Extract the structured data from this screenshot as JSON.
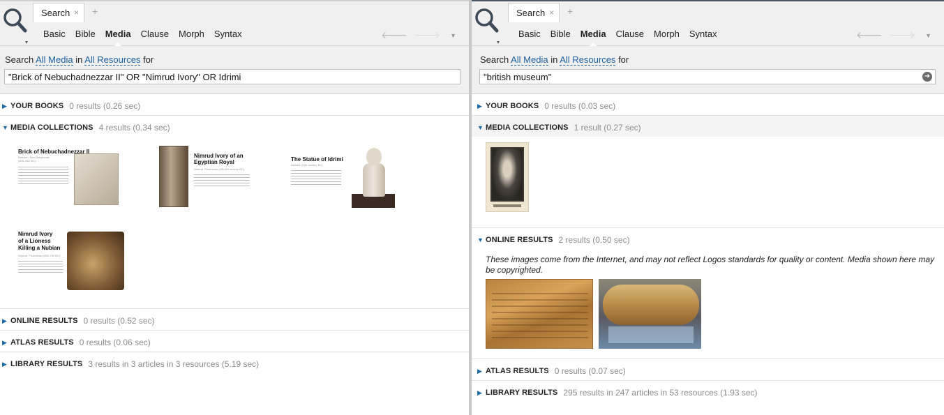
{
  "left": {
    "tab": {
      "label": "Search",
      "close": "×",
      "new": "+"
    },
    "modes": [
      "Basic",
      "Bible",
      "Media",
      "Clause",
      "Morph",
      "Syntax"
    ],
    "search": {
      "prefix": "Search",
      "scope": "All Media",
      "in": "in",
      "resources": "All Resources",
      "for": "for",
      "query": "\"Brick of Nebuchadnezzar II\" OR \"Nimrud Ivory\" OR Idrimi"
    },
    "sections": {
      "your_books": {
        "title": "YOUR BOOKS",
        "count": "0 results (0.26 sec)"
      },
      "media_collections": {
        "title": "MEDIA COLLECTIONS",
        "count": "4 results (0.34 sec)"
      },
      "online_results": {
        "title": "ONLINE RESULTS",
        "count": "0 results (0.52 sec)"
      },
      "atlas_results": {
        "title": "ATLAS RESULTS",
        "count": "0 results (0.06 sec)"
      },
      "library_results": {
        "title": "LIBRARY RESULTS",
        "count": "3 results in 3 articles in 3 resources (5.19 sec)"
      }
    },
    "media_cards": {
      "brick": {
        "title": "Brick of Nebuchadnezzar II",
        "sub": "Babylon, Neo-Babylonian",
        "date": "(605–562 BC)"
      },
      "ivory_royal": {
        "title_1": "Nimrud Ivory of an",
        "title_2": "Egyptian Royal",
        "sub": "Nimrud, Phoenician (9th-8th century BC)"
      },
      "idrimi": {
        "title": "The Statue of Idrimi",
        "sub": "Alalakh (15th century BC)"
      },
      "ivory_lioness": {
        "title_1": "Nimrud Ivory",
        "title_2": "of a Lioness",
        "title_3": "Killing a Nubian",
        "sub": "Nimrud, Phoenician (800-750 BC)"
      }
    }
  },
  "right": {
    "tab": {
      "label": "Search",
      "close": "×",
      "new": "+"
    },
    "modes": [
      "Basic",
      "Bible",
      "Media",
      "Clause",
      "Morph",
      "Syntax"
    ],
    "search": {
      "prefix": "Search",
      "scope": "All Media",
      "in": "in",
      "resources": "All Resources",
      "for": "for",
      "query": "\"british museum\""
    },
    "sections": {
      "your_books": {
        "title": "YOUR BOOKS",
        "count": "0 results (0.03 sec)"
      },
      "media_collections": {
        "title": "MEDIA COLLECTIONS",
        "count": "1 result (0.27 sec)"
      },
      "online_results": {
        "title": "ONLINE RESULTS",
        "count": "2 results (0.50 sec)"
      },
      "atlas_results": {
        "title": "ATLAS RESULTS",
        "count": "0 results (0.07 sec)"
      },
      "library_results": {
        "title": "LIBRARY RESULTS",
        "count": "295 results in 247 articles in 53 resources (1.93 sec)"
      }
    },
    "online_notice": "These images come from the Internet, and may not reflect Logos standards for quality or content. Media shown here may be copyrighted."
  },
  "icons": {
    "search": "magnifier-icon",
    "back": "arrow-left-icon",
    "forward": "arrow-right-icon",
    "menu": "dropdown-icon",
    "go": "go-arrow-icon"
  },
  "colors": {
    "link": "#1a5f9e",
    "triangle": "#1a6aa8",
    "muted": "#8c8c8c",
    "toolbar": "#f0f0f0"
  }
}
